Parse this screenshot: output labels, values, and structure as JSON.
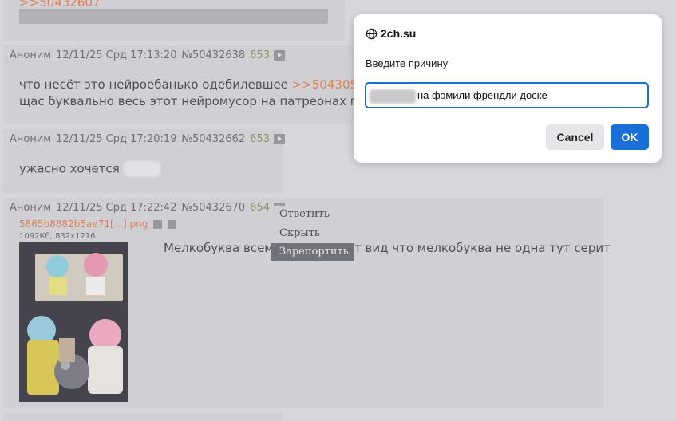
{
  "posts": [
    {
      "reply_link": ">>50432607"
    },
    {
      "author": "Аноним",
      "datetime": "12/11/25 Срд 17:13:20",
      "id": "№50432638",
      "num": "653",
      "text_pre": "что несёт это нейроебанько одебилевшее ",
      "reply_link": ">>50430585",
      "text_post": " ???",
      "line2": "щас буквально весь этот нейромусор на патреонах прода"
    },
    {
      "author": "Аноним",
      "datetime": "12/11/25 Срд 17:20:19",
      "id": "№50432662",
      "num": "653",
      "text": "ужасно хочется "
    },
    {
      "author": "Аноним",
      "datetime": "12/11/25 Срд 17:22:42",
      "id": "№50432670",
      "num": "654",
      "file_name": "5865b8882b5ae71[...].png",
      "file_meta": "1092Кб, 832x1216",
      "text_left": "Мелкобуква всеми",
      "text_right": "т вид что мелкобуква не одна тут серит"
    }
  ],
  "context_menu": {
    "items": [
      "Ответить",
      "Скрыть",
      "Зарепортить"
    ],
    "active_index": 2
  },
  "dialog": {
    "origin": "2ch.su",
    "message": "Введите причину",
    "input_value": "на фэмили френдли доске",
    "cancel_label": "Cancel",
    "ok_label": "OK"
  },
  "colors": {
    "accent": "#1a6ed8",
    "reply_link": "#e0703a",
    "post_num": "#7a8a3a"
  }
}
